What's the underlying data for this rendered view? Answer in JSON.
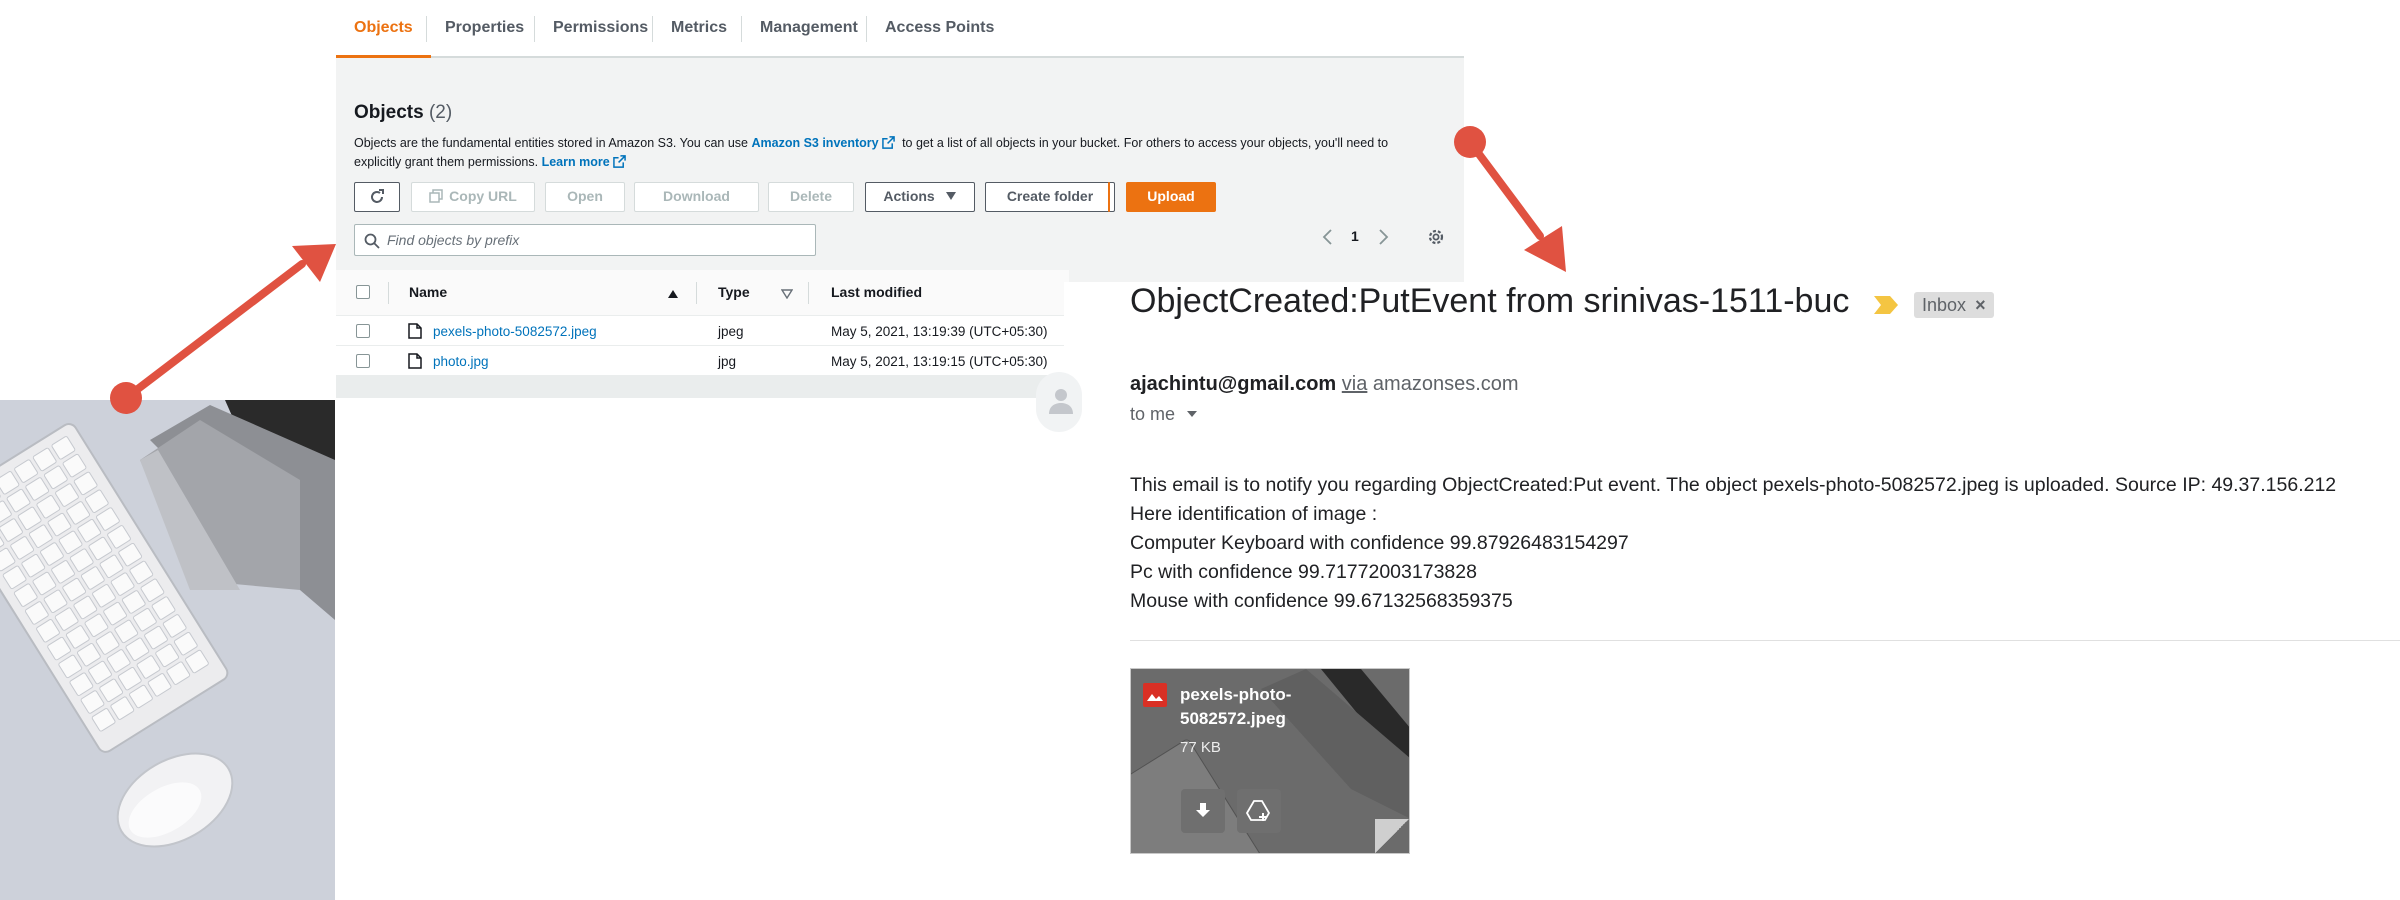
{
  "s3": {
    "tabs": [
      "Objects",
      "Properties",
      "Permissions",
      "Metrics",
      "Management",
      "Access Points"
    ],
    "section_title": "Objects",
    "object_count": "(2)",
    "description": {
      "part1": "Objects are the fundamental entities stored in Amazon S3. You can use ",
      "inventory_link": "Amazon S3 inventory",
      "part2": " to get a list of all objects in your bucket. For others to access your objects, you'll need to explicitly grant them permissions. ",
      "learn_more": "Learn more"
    },
    "toolbar": {
      "copy_url": "Copy URL",
      "open": "Open",
      "download": "Download",
      "delete": "Delete",
      "actions": "Actions",
      "create_folder": "Create folder",
      "upload": "Upload"
    },
    "search_placeholder": "Find objects by prefix",
    "page_number": "1",
    "columns": {
      "name": "Name",
      "type": "Type",
      "last_modified": "Last modified"
    },
    "rows": [
      {
        "name": "pexels-photo-5082572.jpeg",
        "type": "jpeg",
        "last_modified": "May 5, 2021, 13:19:39 (UTC+05:30)"
      },
      {
        "name": "photo.jpg",
        "type": "jpg",
        "last_modified": "May 5, 2021, 13:19:15 (UTC+05:30)"
      }
    ]
  },
  "email": {
    "subject": "ObjectCreated:PutEvent from srinivas-1511-buc",
    "label": "Inbox",
    "label_close": "×",
    "sender_address": "ajachintu@gmail.com",
    "via": "via",
    "sender_domain": "amazonses.com",
    "recipient": "to me",
    "body_lines": [
      "This email is to notify you regarding ObjectCreated:Put event. The object pexels-photo-5082572.jpeg is uploaded. Source IP: 49.37.156.212",
      "Here identification of image :",
      "Computer Keyboard with confidence 99.87926483154297",
      "Pc with confidence 99.71772003173828",
      "Mouse with confidence 99.67132568359375"
    ],
    "attachment": {
      "name_line1": "pexels-photo-",
      "name_line2": "5082572.jpeg",
      "size": "77 KB"
    }
  },
  "colors": {
    "aws_orange": "#ec7211",
    "aws_link": "#0073bb",
    "annotation_arrow": "#e05241",
    "gmail_label_arrow": "#f4c542"
  }
}
